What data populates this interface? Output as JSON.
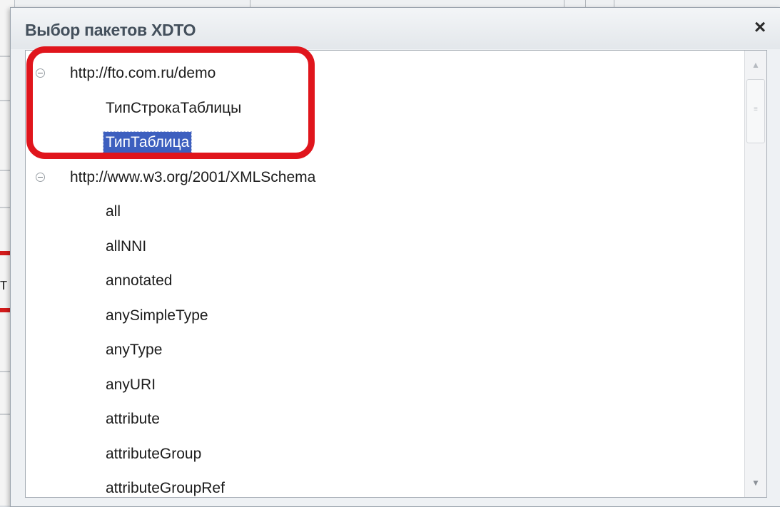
{
  "background": {
    "partial_text": "т"
  },
  "dialog": {
    "title": "Выбор пакетов XDTO",
    "close_label": "×",
    "icons": {
      "expander": "collapse-circle-icon",
      "scroll_up": "scroll-up-arrow-icon",
      "scroll_down": "scroll-down-arrow-icon"
    },
    "colors": {
      "selection": "#3d5fbf",
      "highlight": "#e0151c"
    },
    "tree": {
      "groups": [
        {
          "label": "http://fto.com.ru/demo",
          "expanded": true,
          "items": [
            {
              "label": "ТипСтрокаТаблицы",
              "selected": false
            },
            {
              "label": "ТипТаблица",
              "selected": true
            }
          ]
        },
        {
          "label": "http://www.w3.org/2001/XMLSchema",
          "expanded": true,
          "items": [
            {
              "label": "all"
            },
            {
              "label": "allNNI"
            },
            {
              "label": "annotated"
            },
            {
              "label": "anySimpleType"
            },
            {
              "label": "anyType"
            },
            {
              "label": "anyURI"
            },
            {
              "label": "attribute"
            },
            {
              "label": "attributeGroup"
            },
            {
              "label": "attributeGroupRef"
            }
          ]
        }
      ]
    }
  }
}
